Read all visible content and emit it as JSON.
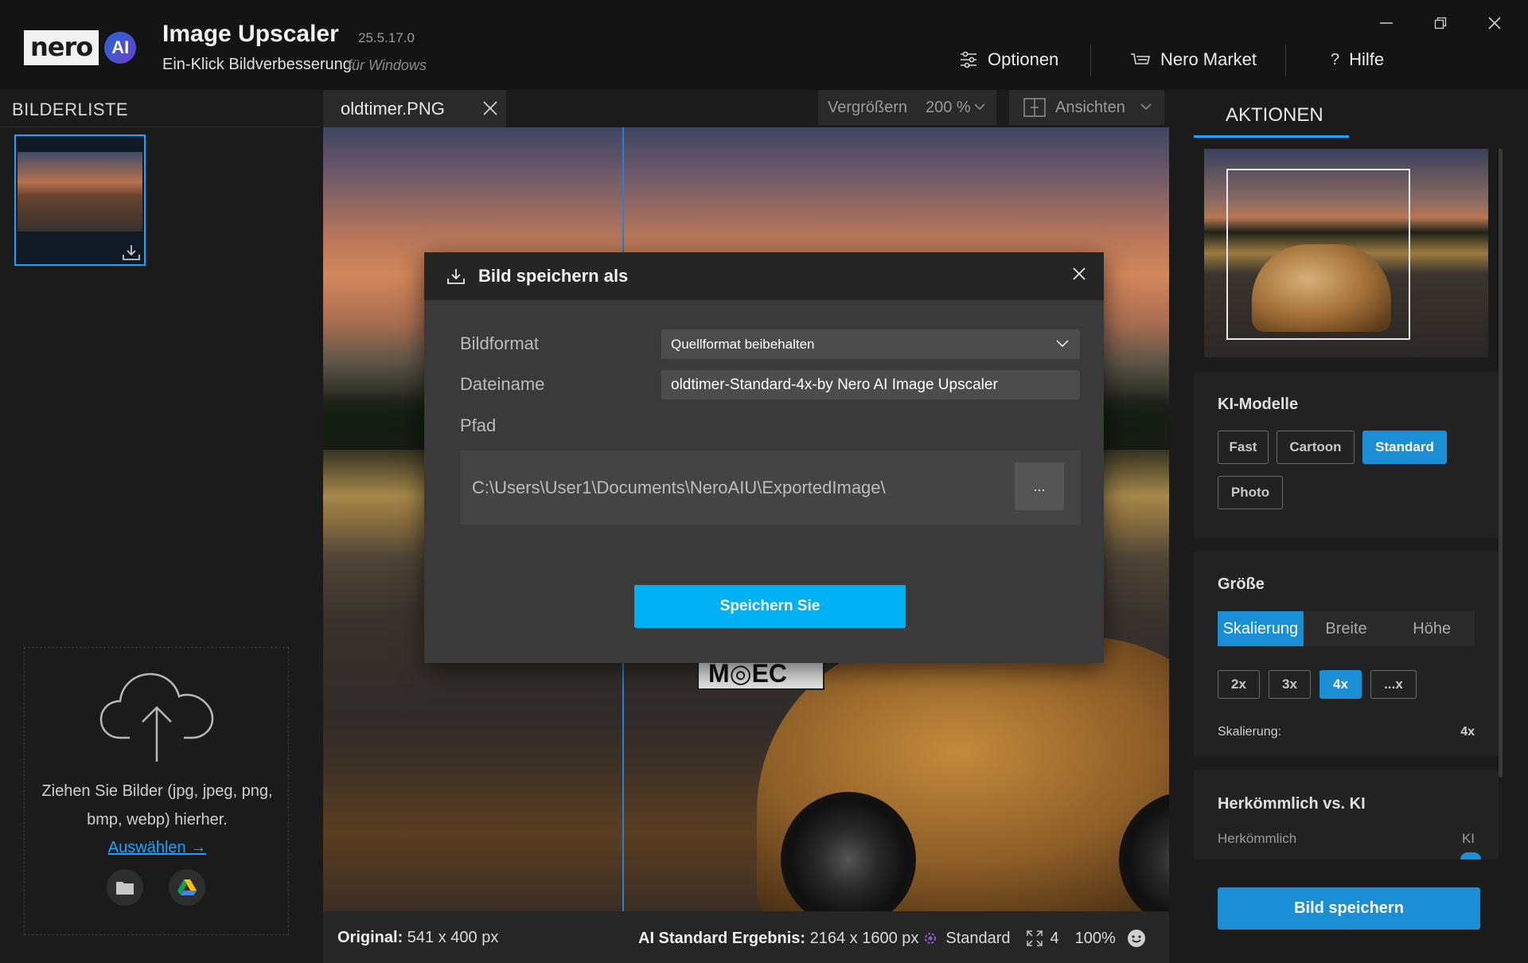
{
  "app": {
    "logo_text": "nero",
    "logo_badge": "AI",
    "title": "Image Upscaler",
    "version": "25.5.17.0",
    "subtitle": "Ein-Klick Bildverbesserung",
    "subtitle_os": "für Windows"
  },
  "top_nav": {
    "options": "Optionen",
    "market": "Nero Market",
    "help_glyph": "?",
    "help": "Hilfe"
  },
  "left_panel": {
    "heading": "BILDERLISTE",
    "dropzone_line1": "Ziehen Sie Bilder (jpg, jpeg, png,",
    "dropzone_line2": "bmp, webp) hierher.",
    "select_link": "Auswählen →"
  },
  "center": {
    "tab_name": "oldtimer.PNG",
    "zoom_label": "Vergrößern",
    "zoom_value": "200 %",
    "view_label": "Ansichten",
    "plate_text": "M◎EC"
  },
  "status": {
    "original_label": "Original:",
    "original_value": "541 x 400 px",
    "result_label": "AI Standard Ergebnis:",
    "result_value": "2164 x 1600 px",
    "model": "Standard",
    "scale": "4",
    "zoom": "100%"
  },
  "modal": {
    "title": "Bild speichern als",
    "format_label": "Bildformat",
    "format_value": "Quellformat beibehalten",
    "filename_label": "Dateiname",
    "filename_value": "oldtimer-Standard-4x-by Nero AI Image Upscaler",
    "path_label": "Pfad",
    "path_value": "C:\\Users\\User1\\Documents\\NeroAIU\\ExportedImage\\",
    "browse": "...",
    "save_button": "Speichern Sie"
  },
  "right_panel": {
    "tab": "AKTIONEN",
    "models": {
      "title": "KI-Modelle",
      "items": [
        "Fast",
        "Cartoon",
        "Standard",
        "Photo"
      ],
      "selected": "Standard"
    },
    "size": {
      "title": "Größe",
      "modes": [
        "Skalierung",
        "Breite",
        "Höhe"
      ],
      "selected_mode": "Skalierung",
      "multipliers": [
        "2x",
        "3x",
        "4x",
        "...x"
      ],
      "selected_multiplier": "4x",
      "scale_label": "Skalierung:",
      "scale_value": "4x"
    },
    "compare": {
      "title": "Herkömmlich vs. KI",
      "left_label": "Herkömmlich",
      "right_label": "KI"
    },
    "save_button": "Bild speichern"
  },
  "colors": {
    "accent": "#1a8fd6",
    "accent_bright": "#00b0f5",
    "link": "#1aa3ff",
    "background": "#1b1b1b"
  }
}
